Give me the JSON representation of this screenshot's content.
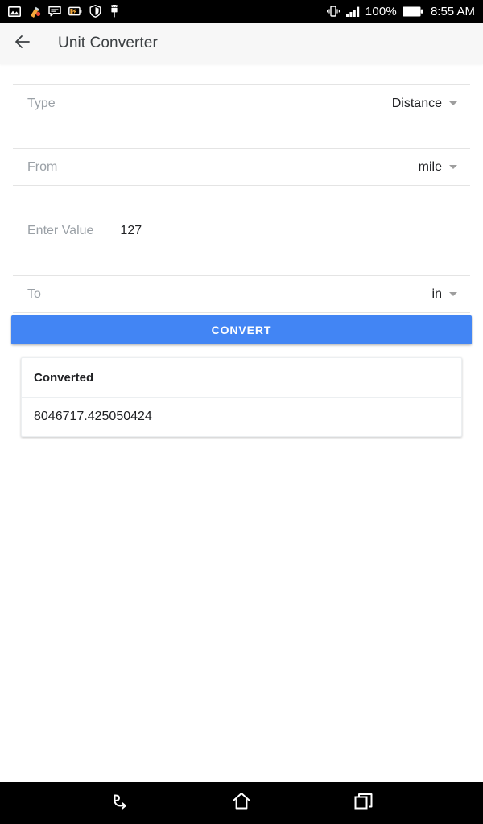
{
  "status_bar": {
    "left_icons": [
      {
        "name": "gallery-icon",
        "label": "Gallery"
      },
      {
        "name": "cleaner-icon",
        "label": "Cleaner"
      },
      {
        "name": "message-icon",
        "label": "Messages"
      },
      {
        "name": "battery-saver-icon",
        "label": "Battery saver"
      },
      {
        "name": "shield-icon",
        "label": "Security"
      },
      {
        "name": "android-debug-icon",
        "label": "USB debugging"
      }
    ],
    "vibrate_icon": "vibrate-icon",
    "signal_icon": "signal-bars-icon",
    "battery_percent": "100%",
    "battery_icon": "battery-full-icon",
    "time": "8:55 AM"
  },
  "app_bar": {
    "back_icon": "back-arrow-icon",
    "title": "Unit Converter"
  },
  "form": {
    "type_row": {
      "label": "Type",
      "value": "Distance",
      "caret_icon": "chevron-down-icon"
    },
    "from_row": {
      "label": "From",
      "value": "mile",
      "caret_icon": "chevron-down-icon"
    },
    "value_row": {
      "label": "Enter Value",
      "value": "127",
      "placeholder": "Enter Value"
    },
    "to_row": {
      "label": "To",
      "value": "in",
      "caret_icon": "chevron-down-icon"
    },
    "convert_button": "CONVERT"
  },
  "result_card": {
    "header": "Converted",
    "value": "8046717.425050424"
  },
  "nav_bar": {
    "back": "back-nav-icon",
    "home": "home-nav-icon",
    "recents": "recents-nav-icon"
  },
  "colors": {
    "accent": "#4285f4",
    "appbar_bg": "#f7f7f7",
    "label_gray": "#9aa0a6",
    "text_dark": "#202124",
    "divider": "#e4e4e4"
  }
}
